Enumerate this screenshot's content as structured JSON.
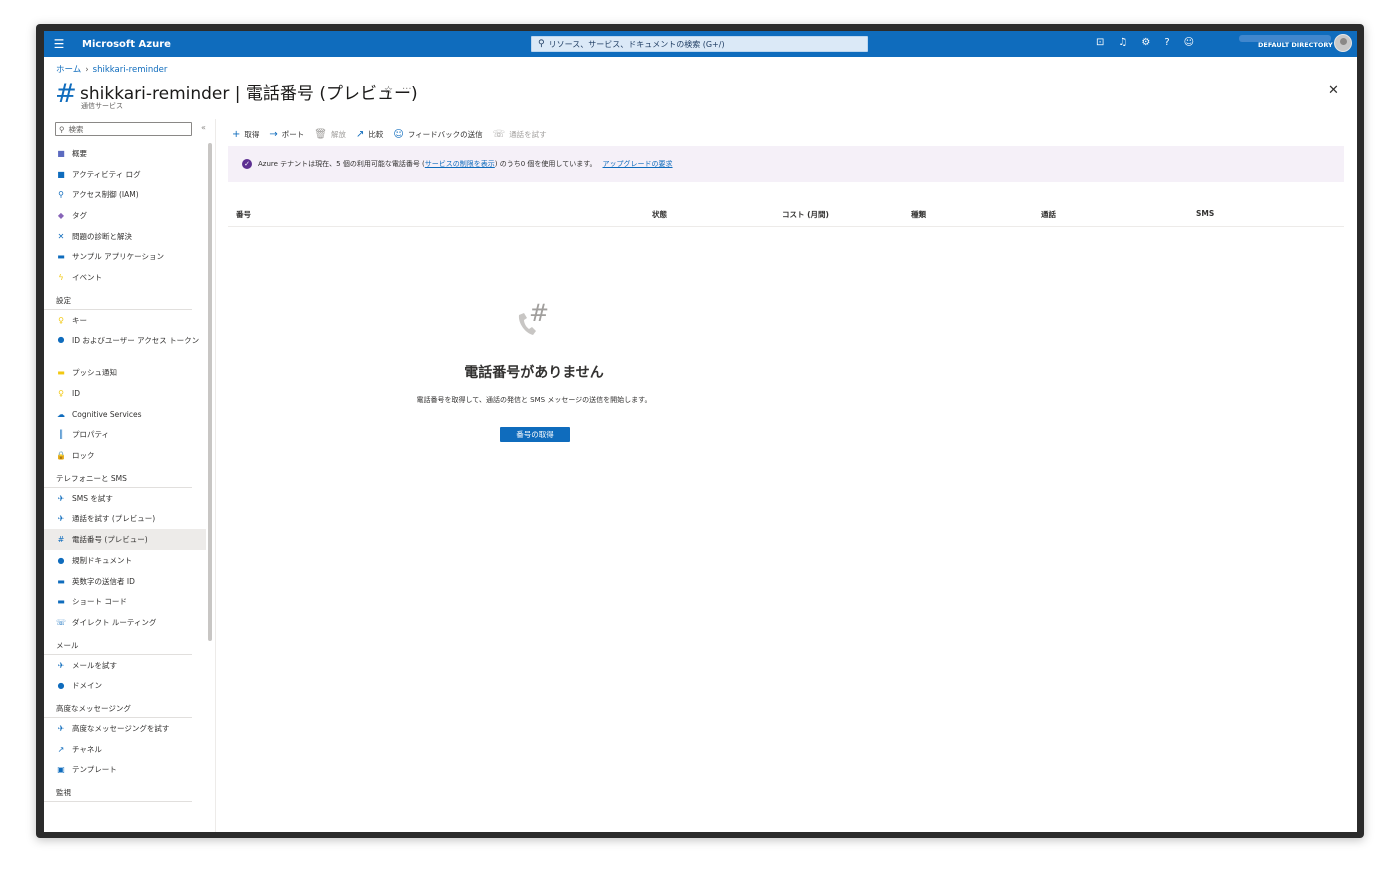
{
  "topbar": {
    "brand": "Microsoft Azure",
    "search_placeholder": "リソース、サービス、ドキュメントの検索 (G+/)",
    "directory": "DEFAULT DIRECTORY",
    "icons": [
      "cloud-shell-icon",
      "bell-icon",
      "gear-icon",
      "help-icon",
      "feedback-icon"
    ]
  },
  "breadcrumb": {
    "home": "ホーム",
    "current": "shikkari-reminder"
  },
  "header": {
    "title": "shikkari-reminder | 電話番号 (プレビュー)",
    "subtitle": "通信サービス"
  },
  "sidebar": {
    "search_placeholder": "検索",
    "items": [
      {
        "type": "item",
        "label": "概要",
        "icon": "■",
        "color": "#5c6bc0"
      },
      {
        "type": "item",
        "label": "アクティビティ ログ",
        "icon": "■",
        "color": "#0f6cbd"
      },
      {
        "type": "item",
        "label": "アクセス制御 (IAM)",
        "icon": "⚲",
        "color": "#0f6cbd"
      },
      {
        "type": "item",
        "label": "タグ",
        "icon": "◆",
        "color": "#8764b8"
      },
      {
        "type": "item",
        "label": "問題の診断と解決",
        "icon": "✕",
        "color": "#0f6cbd"
      },
      {
        "type": "item",
        "label": "サンプル アプリケーション",
        "icon": "▬",
        "color": "#0f6cbd"
      },
      {
        "type": "item",
        "label": "イベント",
        "icon": "ϟ",
        "color": "#f2c811"
      },
      {
        "type": "section",
        "label": "設定"
      },
      {
        "type": "item",
        "label": "キー",
        "icon": "♀",
        "color": "#f2c811"
      },
      {
        "type": "item",
        "label": "ID およびユーザー アクセス トークン",
        "icon": "●",
        "color": "#0f6cbd",
        "tall": true
      },
      {
        "type": "item",
        "label": "プッシュ通知",
        "icon": "▬",
        "color": "#f2c811"
      },
      {
        "type": "item",
        "label": "ID",
        "icon": "♀",
        "color": "#f2c811"
      },
      {
        "type": "item",
        "label": "Cognitive Services",
        "icon": "☁",
        "color": "#0f6cbd"
      },
      {
        "type": "item",
        "label": "プロパティ",
        "icon": "║",
        "color": "#0f6cbd"
      },
      {
        "type": "item",
        "label": "ロック",
        "icon": "🔒",
        "color": "#0f6cbd"
      },
      {
        "type": "section",
        "label": "テレフォニーと SMS"
      },
      {
        "type": "item",
        "label": "SMS を試す",
        "icon": "✈",
        "color": "#0f6cbd"
      },
      {
        "type": "item",
        "label": "通話を試す (プレビュー)",
        "icon": "✈",
        "color": "#0f6cbd"
      },
      {
        "type": "item",
        "label": "電話番号 (プレビュー)",
        "icon": "#",
        "color": "#0f6cbd",
        "active": true
      },
      {
        "type": "item",
        "label": "規制ドキュメント",
        "icon": "●",
        "color": "#0f6cbd"
      },
      {
        "type": "item",
        "label": "英数字の送信者 ID",
        "icon": "▬",
        "color": "#0f6cbd"
      },
      {
        "type": "item",
        "label": "ショート コード",
        "icon": "▬",
        "color": "#0f6cbd"
      },
      {
        "type": "item",
        "label": "ダイレクト ルーティング",
        "icon": "☏",
        "color": "#0f6cbd"
      },
      {
        "type": "section",
        "label": "メール"
      },
      {
        "type": "item",
        "label": "メールを試す",
        "icon": "✈",
        "color": "#0f6cbd"
      },
      {
        "type": "item",
        "label": "ドメイン",
        "icon": "●",
        "color": "#0f6cbd"
      },
      {
        "type": "section",
        "label": "高度なメッセージング"
      },
      {
        "type": "item",
        "label": "高度なメッセージングを試す",
        "icon": "✈",
        "color": "#0f6cbd"
      },
      {
        "type": "item",
        "label": "チャネル",
        "icon": "↗",
        "color": "#0f6cbd"
      },
      {
        "type": "item",
        "label": "テンプレート",
        "icon": "▣",
        "color": "#0f6cbd"
      },
      {
        "type": "section",
        "label": "監視"
      }
    ]
  },
  "toolbar": {
    "get": "取得",
    "port": "ポート",
    "release": "解放",
    "compare": "比較",
    "feedback": "フィードバックの送信",
    "try_call": "通話を試す"
  },
  "banner": {
    "prefix": "Azure テナントは現在、5 個の利用可能な電話番号 (",
    "limit_link": "サービスの制限を表示",
    "middle": ") のうち0 個を使用しています。",
    "upgrade_link": "アップグレードの要求"
  },
  "table": {
    "columns": [
      "番号",
      "状態",
      "コスト (月間)",
      "種類",
      "通話",
      "SMS"
    ]
  },
  "empty": {
    "title": "電話番号がありません",
    "description": "電話番号を取得して、通話の発信と SMS メッセージの送信を開始します。",
    "button": "番号の取得"
  }
}
